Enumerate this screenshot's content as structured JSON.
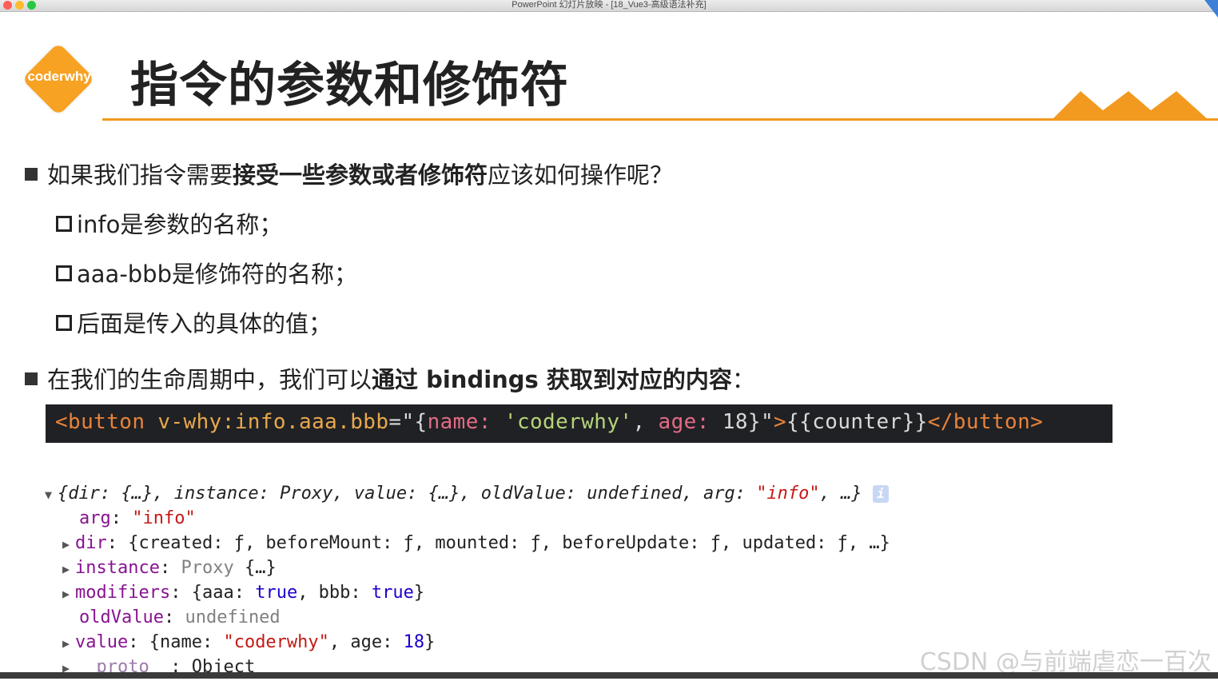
{
  "window": {
    "title": "PowerPoint 幻灯片放映 - [18_Vue3-高级语法补充]"
  },
  "header": {
    "logo_text": "coderwhy",
    "title": "指令的参数和修饰符"
  },
  "bullets": [
    {
      "parts": [
        "如果我们指令需要",
        "接受一些参数或者修饰符",
        "应该如何操作呢？"
      ]
    },
    {
      "parts": [
        "在我们的生命周期中，我们可以",
        "通过 bindings 获取到对应的内容",
        "："
      ]
    }
  ],
  "sub_bullets": [
    "info是参数的名称；",
    "aaa-bbb是修饰符的名称；",
    "后面是传入的具体的值；"
  ],
  "code": {
    "open_tag": "<button",
    "directive": " v-why:info.aaa.bbb",
    "eq_open": "=\"{",
    "k_name": "name:",
    "v_name": " 'coderwhy'",
    "comma": ", ",
    "k_age": "age:",
    "v_age": " 18}\"",
    "close_gt": ">",
    "content": "{{counter}}",
    "close_tag": "</button>"
  },
  "console": {
    "summary": {
      "p1": "{dir: {…}, instance: Proxy, value: {…}, oldValue: undefined, arg: ",
      "arg": "\"info\"",
      "p2": ", …}",
      "icon": "i"
    },
    "rows": {
      "arg_key": "arg",
      "arg_val": "\"info\"",
      "dir_key": "dir",
      "dir_val": "{created: ƒ, beforeMount: ƒ, mounted: ƒ, beforeUpdate: ƒ, updated: ƒ, …}",
      "instance_key": "instance",
      "instance_type": "Proxy",
      "instance_val": "{…}",
      "modifiers_key": "modifiers",
      "modifiers_p1": "{aaa: ",
      "modifiers_true1": "true",
      "modifiers_p2": ", bbb: ",
      "modifiers_true2": "true",
      "modifiers_p3": "}",
      "oldValue_key": "oldValue",
      "oldValue_val": "undefined",
      "value_key": "value",
      "value_p1": "{name: ",
      "value_name": "\"coderwhy\"",
      "value_p2": ", age: ",
      "value_age": "18",
      "value_p3": "}",
      "proto_key": "__proto__",
      "proto_val": "Object"
    }
  },
  "watermark": "CSDN @与前端虐恋一百次",
  "colors": {
    "accent_orange": "#f29a1f",
    "logo_orange": "#f7a223",
    "code_bg": "#202124"
  }
}
